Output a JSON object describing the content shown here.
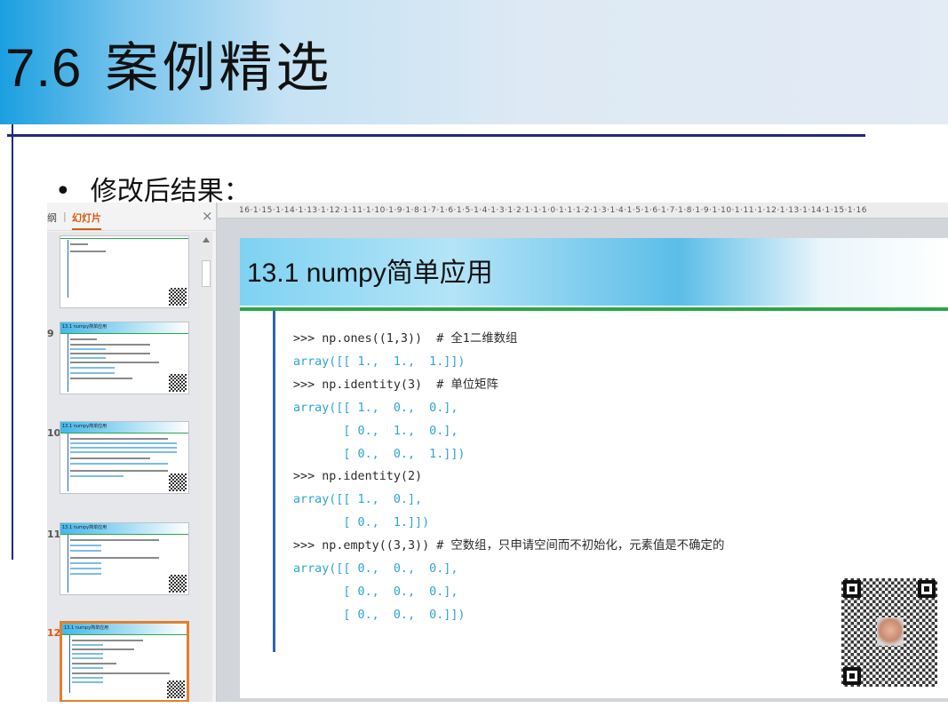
{
  "slide": {
    "title_number": "7.6",
    "title_text": "案例精选",
    "bullet_symbol": "•",
    "bullet_text": "修改后结果："
  },
  "panel": {
    "tab_outline": "纲",
    "tab_separator": "|",
    "tab_slides": "幻灯片",
    "close_symbol": "×",
    "slide_numbers": [
      "9",
      "10",
      "11",
      "12"
    ],
    "thumb_title": "13.1 numpy简单应用"
  },
  "ruler": {
    "text": "16·1·15·1·14·1·13·1·12·1·11·1·10·1·9·1·8·1·7·1·6·1·5·1·4·1·3·1·2·1·1·1·0·1·1·1·2·1·3·1·4·1·5·1·6·1·7·1·8·1·9·1·10·1·11·1·12·1·13·1·14·1·15·1·16"
  },
  "inner_slide": {
    "title": "13.1 numpy简单应用",
    "code_lines": [
      {
        "kind": "cmd",
        "text": ">>> np.ones((1,3))  # 全1二维数组"
      },
      {
        "kind": "out",
        "text": "array([[ 1.,  1.,  1.]])"
      },
      {
        "kind": "cmd",
        "text": ">>> np.identity(3)  # 单位矩阵"
      },
      {
        "kind": "out",
        "text": "array([[ 1.,  0.,  0.],"
      },
      {
        "kind": "out",
        "text": "       [ 0.,  1.,  0.],"
      },
      {
        "kind": "out",
        "text": "       [ 0.,  0.,  1.]])"
      },
      {
        "kind": "cmd",
        "text": ">>> np.identity(2)"
      },
      {
        "kind": "out",
        "text": "array([[ 1.,  0.],"
      },
      {
        "kind": "out",
        "text": "       [ 0.,  1.]])"
      },
      {
        "kind": "cmd",
        "text": ">>> np.empty((3,3)) # 空数组，只申请空间而不初始化，元素值是不确定的"
      },
      {
        "kind": "out",
        "text": "array([[ 0.,  0.,  0.],"
      },
      {
        "kind": "out",
        "text": "       [ 0.,  0.,  0.],"
      },
      {
        "kind": "out",
        "text": "       [ 0.,  0.,  0.]])"
      }
    ]
  },
  "icons": {
    "qr": "qr-code-icon",
    "scroll_up": "scroll-up-arrow-icon"
  }
}
